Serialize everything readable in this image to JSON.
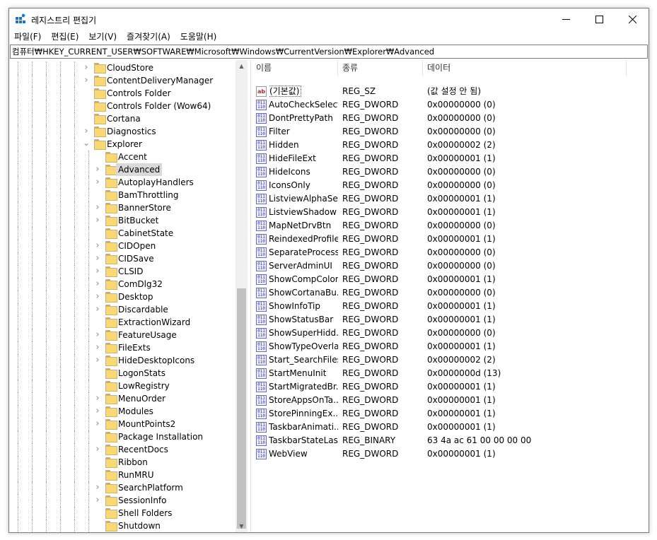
{
  "app": {
    "title": "레지스트리 편집기",
    "icon": "regedit-icon"
  },
  "window_buttons": {
    "minimize": "minimize-icon",
    "maximize": "maximize-icon",
    "close": "close-icon"
  },
  "menu": [
    "파일(F)",
    "편집(E)",
    "보기(V)",
    "즐겨찾기(A)",
    "도움말(H)"
  ],
  "address": "컴퓨터₩HKEY_CURRENT_USER₩SOFTWARE₩Microsoft₩Windows₩CurrentVersion₩Explorer₩Advanced",
  "tree": {
    "selected": "Advanced",
    "parent_items": [
      {
        "label": "CloudStore",
        "expandable": true
      },
      {
        "label": "ContentDeliveryManager",
        "expandable": true
      },
      {
        "label": "Controls Folder",
        "expandable": false
      },
      {
        "label": "Controls Folder (Wow64)",
        "expandable": false
      },
      {
        "label": "Cortana",
        "expandable": false
      },
      {
        "label": "Diagnostics",
        "expandable": true
      },
      {
        "label": "Explorer",
        "expandable": true,
        "expanded": true
      }
    ],
    "child_items": [
      {
        "label": "Accent",
        "expandable": false
      },
      {
        "label": "Advanced",
        "expandable": true
      },
      {
        "label": "AutoplayHandlers",
        "expandable": true
      },
      {
        "label": "BamThrottling",
        "expandable": false
      },
      {
        "label": "BannerStore",
        "expandable": true
      },
      {
        "label": "BitBucket",
        "expandable": true
      },
      {
        "label": "CabinetState",
        "expandable": false
      },
      {
        "label": "CIDOpen",
        "expandable": true
      },
      {
        "label": "CIDSave",
        "expandable": true
      },
      {
        "label": "CLSID",
        "expandable": true
      },
      {
        "label": "ComDlg32",
        "expandable": true
      },
      {
        "label": "Desktop",
        "expandable": true
      },
      {
        "label": "Discardable",
        "expandable": true
      },
      {
        "label": "ExtractionWizard",
        "expandable": false
      },
      {
        "label": "FeatureUsage",
        "expandable": true
      },
      {
        "label": "FileExts",
        "expandable": true
      },
      {
        "label": "HideDesktopIcons",
        "expandable": true
      },
      {
        "label": "LogonStats",
        "expandable": false
      },
      {
        "label": "LowRegistry",
        "expandable": false
      },
      {
        "label": "MenuOrder",
        "expandable": true
      },
      {
        "label": "Modules",
        "expandable": true
      },
      {
        "label": "MountPoints2",
        "expandable": true
      },
      {
        "label": "Package Installation",
        "expandable": false
      },
      {
        "label": "RecentDocs",
        "expandable": true
      },
      {
        "label": "Ribbon",
        "expandable": false
      },
      {
        "label": "RunMRU",
        "expandable": false
      },
      {
        "label": "SearchPlatform",
        "expandable": true
      },
      {
        "label": "SessionInfo",
        "expandable": true
      },
      {
        "label": "Shell Folders",
        "expandable": false
      },
      {
        "label": "Shutdown",
        "expandable": false
      }
    ]
  },
  "columns": {
    "name": "이름",
    "type": "종류",
    "data": "데이터"
  },
  "values": [
    {
      "name": "(기본값)",
      "type": "REG_SZ",
      "data": "(값 설정 안 됨)",
      "icon": "string-value-icon"
    },
    {
      "name": "AutoCheckSelect",
      "type": "REG_DWORD",
      "data": "0x00000000 (0)",
      "icon": "binary-value-icon"
    },
    {
      "name": "DontPrettyPath",
      "type": "REG_DWORD",
      "data": "0x00000000 (0)",
      "icon": "binary-value-icon"
    },
    {
      "name": "Filter",
      "type": "REG_DWORD",
      "data": "0x00000000 (0)",
      "icon": "binary-value-icon"
    },
    {
      "name": "Hidden",
      "type": "REG_DWORD",
      "data": "0x00000002 (2)",
      "icon": "binary-value-icon"
    },
    {
      "name": "HideFileExt",
      "type": "REG_DWORD",
      "data": "0x00000001 (1)",
      "icon": "binary-value-icon"
    },
    {
      "name": "HideIcons",
      "type": "REG_DWORD",
      "data": "0x00000000 (0)",
      "icon": "binary-value-icon"
    },
    {
      "name": "IconsOnly",
      "type": "REG_DWORD",
      "data": "0x00000000 (0)",
      "icon": "binary-value-icon"
    },
    {
      "name": "ListviewAlphaSe...",
      "type": "REG_DWORD",
      "data": "0x00000001 (1)",
      "icon": "binary-value-icon"
    },
    {
      "name": "ListviewShadow",
      "type": "REG_DWORD",
      "data": "0x00000001 (1)",
      "icon": "binary-value-icon"
    },
    {
      "name": "MapNetDrvBtn",
      "type": "REG_DWORD",
      "data": "0x00000000 (0)",
      "icon": "binary-value-icon"
    },
    {
      "name": "ReindexedProfile",
      "type": "REG_DWORD",
      "data": "0x00000001 (1)",
      "icon": "binary-value-icon"
    },
    {
      "name": "SeparateProcess",
      "type": "REG_DWORD",
      "data": "0x00000000 (0)",
      "icon": "binary-value-icon"
    },
    {
      "name": "ServerAdminUI",
      "type": "REG_DWORD",
      "data": "0x00000000 (0)",
      "icon": "binary-value-icon"
    },
    {
      "name": "ShowCompColor",
      "type": "REG_DWORD",
      "data": "0x00000001 (1)",
      "icon": "binary-value-icon"
    },
    {
      "name": "ShowCortanaBu...",
      "type": "REG_DWORD",
      "data": "0x00000000 (0)",
      "icon": "binary-value-icon"
    },
    {
      "name": "ShowInfoTip",
      "type": "REG_DWORD",
      "data": "0x00000001 (1)",
      "icon": "binary-value-icon"
    },
    {
      "name": "ShowStatusBar",
      "type": "REG_DWORD",
      "data": "0x00000001 (1)",
      "icon": "binary-value-icon"
    },
    {
      "name": "ShowSuperHidd...",
      "type": "REG_DWORD",
      "data": "0x00000000 (0)",
      "icon": "binary-value-icon"
    },
    {
      "name": "ShowTypeOverlay",
      "type": "REG_DWORD",
      "data": "0x00000001 (1)",
      "icon": "binary-value-icon"
    },
    {
      "name": "Start_SearchFiles",
      "type": "REG_DWORD",
      "data": "0x00000002 (2)",
      "icon": "binary-value-icon"
    },
    {
      "name": "StartMenuInit",
      "type": "REG_DWORD",
      "data": "0x0000000d (13)",
      "icon": "binary-value-icon"
    },
    {
      "name": "StartMigratedBr...",
      "type": "REG_DWORD",
      "data": "0x00000001 (1)",
      "icon": "binary-value-icon"
    },
    {
      "name": "StoreAppsOnTa...",
      "type": "REG_DWORD",
      "data": "0x00000001 (1)",
      "icon": "binary-value-icon"
    },
    {
      "name": "StorePinningEx...",
      "type": "REG_DWORD",
      "data": "0x00000001 (1)",
      "icon": "binary-value-icon"
    },
    {
      "name": "TaskbarAnimati...",
      "type": "REG_DWORD",
      "data": "0x00000001 (1)",
      "icon": "binary-value-icon"
    },
    {
      "name": "TaskbarStateLas...",
      "type": "REG_BINARY",
      "data": "63 4a ac 61 00 00 00 00",
      "icon": "binary-value-icon"
    },
    {
      "name": "WebView",
      "type": "REG_DWORD",
      "data": "0x00000001 (1)",
      "icon": "binary-value-icon"
    }
  ]
}
